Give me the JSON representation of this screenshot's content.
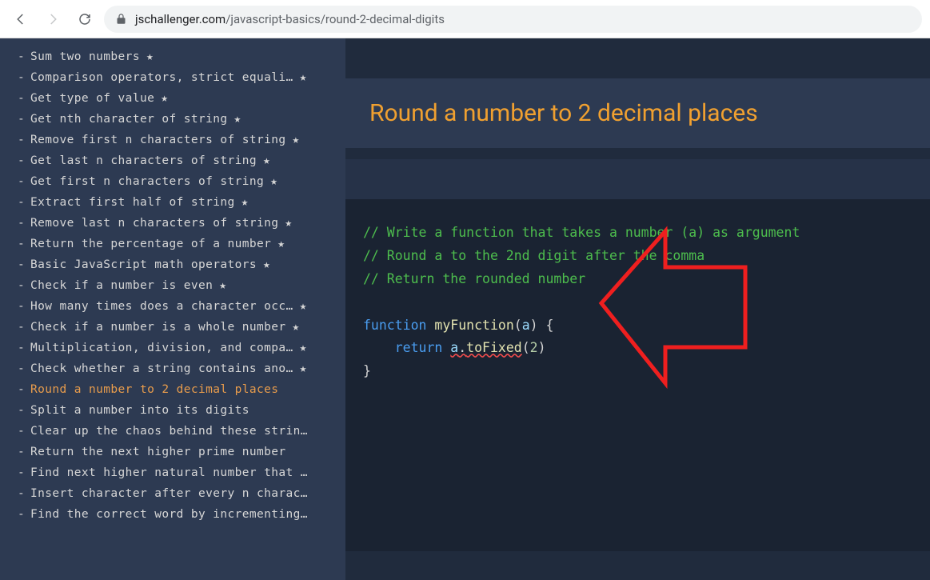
{
  "browser": {
    "url_prefix": "jschallenger.com",
    "url_path": "/javascript-basics/round-2-decimal-digits"
  },
  "sidebar": {
    "items": [
      {
        "label": "Sum two numbers",
        "star": true,
        "active": false
      },
      {
        "label": "Comparison operators, strict equali…",
        "star": true,
        "active": false
      },
      {
        "label": "Get type of value",
        "star": true,
        "active": false
      },
      {
        "label": "Get nth character of string",
        "star": true,
        "active": false
      },
      {
        "label": "Remove first n characters of string",
        "star": true,
        "active": false
      },
      {
        "label": "Get last n characters of string",
        "star": true,
        "active": false
      },
      {
        "label": "Get first n characters of string",
        "star": true,
        "active": false
      },
      {
        "label": "Extract first half of string",
        "star": true,
        "active": false
      },
      {
        "label": "Remove last n characters of string",
        "star": true,
        "active": false
      },
      {
        "label": "Return the percentage of a number",
        "star": true,
        "active": false
      },
      {
        "label": "Basic JavaScript math operators",
        "star": true,
        "active": false
      },
      {
        "label": "Check if a number is even",
        "star": true,
        "active": false
      },
      {
        "label": "How many times does a character occ…",
        "star": true,
        "active": false
      },
      {
        "label": "Check if a number is a whole number",
        "star": true,
        "active": false
      },
      {
        "label": "Multiplication, division, and compa…",
        "star": true,
        "active": false
      },
      {
        "label": "Check whether a string contains ano…",
        "star": true,
        "active": false
      },
      {
        "label": "Round a number to 2 decimal places",
        "star": false,
        "active": true
      },
      {
        "label": "Split a number into its digits",
        "star": false,
        "active": false
      },
      {
        "label": "Clear up the chaos behind these strin…",
        "star": false,
        "active": false
      },
      {
        "label": "Return the next higher prime number",
        "star": false,
        "active": false
      },
      {
        "label": "Find next higher natural number that …",
        "star": false,
        "active": false
      },
      {
        "label": "Insert character after every n charac…",
        "star": false,
        "active": false
      },
      {
        "label": "Find the correct word by incrementing…",
        "star": false,
        "active": false
      }
    ]
  },
  "page": {
    "title": "Round a number to 2 decimal places"
  },
  "code": {
    "comment1": "// Write a function that takes a number (a) as argument",
    "comment2": "// Round a to the 2nd digit after the comma",
    "comment3": "// Return the rounded number",
    "kw_function": "function",
    "fn_name": "myFunction",
    "param": "a",
    "kw_return": "return",
    "expr_ident": "a",
    "expr_dot": ".",
    "expr_method": "toFixed",
    "expr_arg": "2"
  }
}
